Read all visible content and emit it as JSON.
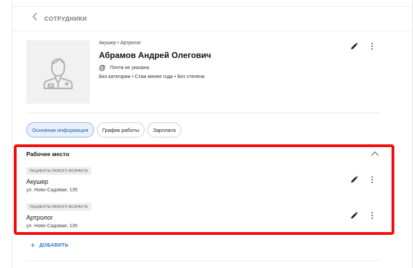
{
  "header": {
    "back_label": "СОТРУДНИКИ"
  },
  "profile": {
    "subtitle": "Акушер • Артролог",
    "name": "Абрамов Андрей Олегович",
    "email_icon": "at-icon",
    "email_text": "Почта не указана",
    "meta": "Без категории • Стаж менее года • Без степени"
  },
  "tabs": [
    {
      "label": "Основная информация",
      "active": true
    },
    {
      "label": "График работы",
      "active": false
    },
    {
      "label": "Зарплата",
      "active": false
    }
  ],
  "workplace": {
    "title": "Рабочее место",
    "items": [
      {
        "chip": "ПАЦИЕНТЫ ЛЮБОГО ВОЗРАСТА",
        "role": "Акушер",
        "address": "ул. Ново-Садовая, 135"
      },
      {
        "chip": "ПАЦИЕНТЫ ЛЮБОГО ВОЗРАСТА",
        "role": "Артролог",
        "address": "ул. Ново-Садовая, 135"
      }
    ],
    "add_label": "ДОБАВИТЬ"
  },
  "colors": {
    "accent": "#2a6fc9",
    "highlight_border": "#f20d0d",
    "active_tab_bg": "#e8f1fb"
  }
}
